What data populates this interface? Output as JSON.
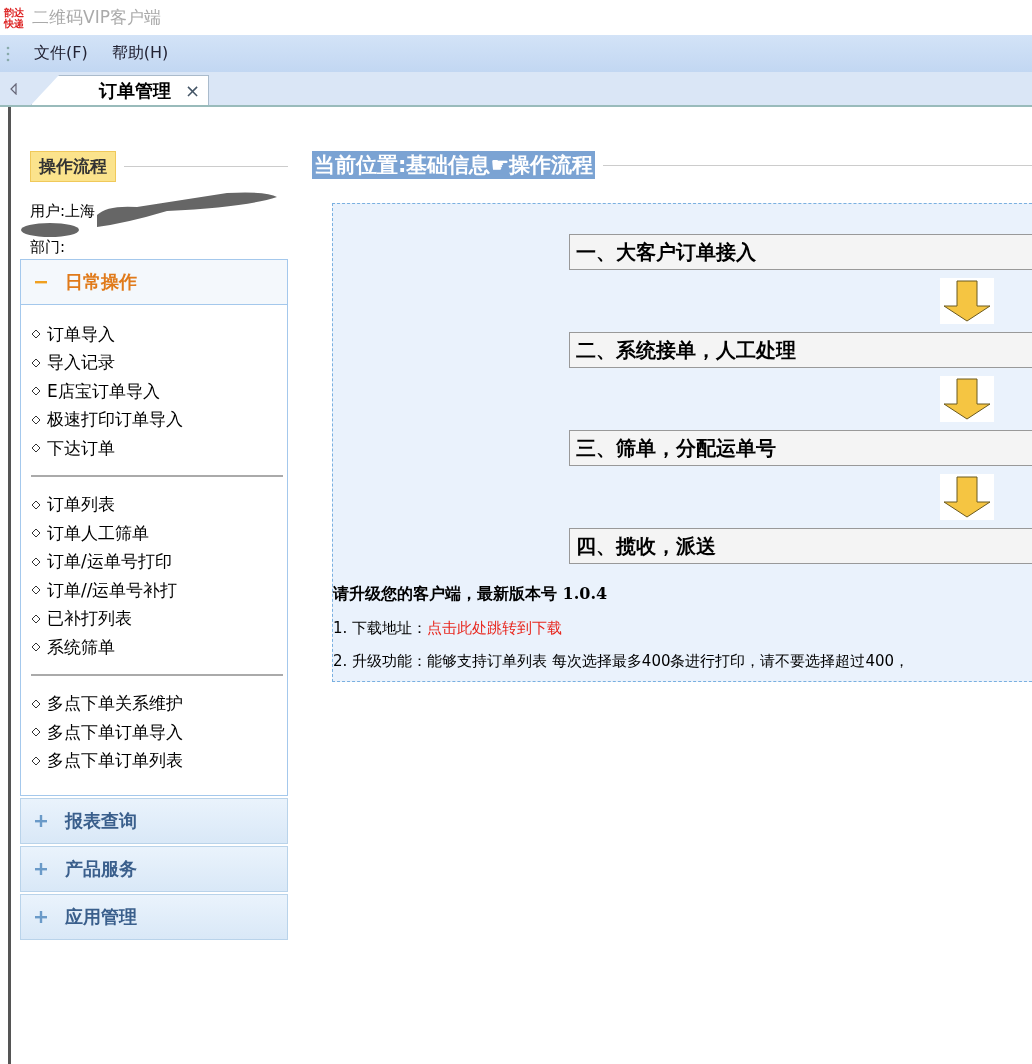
{
  "window": {
    "logo_text": [
      "韵达",
      "快递"
    ],
    "title": "二维码VIP客户端"
  },
  "menu": [
    "文件(F)",
    "帮助(H)"
  ],
  "tabs": [
    {
      "label": "订单管理",
      "selected": true,
      "close": "×"
    }
  ],
  "sidebar": {
    "heading": "操作流程",
    "user": "用户:上海",
    "department": "部门:",
    "sections": [
      {
        "title": "日常操作",
        "expanded": true,
        "groups": [
          [
            "订单导入",
            "导入记录",
            "E店宝订单导入",
            "极速打印订单导入",
            "下达订单"
          ],
          [
            "订单列表",
            "订单人工筛单",
            "订单/运单号打印",
            "订单//运单号补打",
            "已补打列表",
            "系统筛单"
          ],
          [
            "多点下单关系维护",
            "多点下单订单导入",
            "多点下单订单列表"
          ]
        ]
      },
      {
        "title": "报表查询",
        "expanded": false
      },
      {
        "title": "产品服务",
        "expanded": false
      },
      {
        "title": "应用管理",
        "expanded": false
      }
    ]
  },
  "breadcrumb": "当前位置:基础信息☛操作流程",
  "steps": [
    "一、大客户订单接入",
    "二、系统接单，人工处理",
    "三、筛单，分配运单号",
    "四、揽收，派送"
  ],
  "notice": {
    "heading": "请升级您的客户端，最新版本号 1.0.4",
    "lines": [
      {
        "label": "1. 下载地址：",
        "link": "点击此处跳转到下载"
      },
      {
        "label": "2. 升级功能：能够支持订单列表 每次选择最多400条进行打印，请不要选择超过400，"
      }
    ]
  }
}
